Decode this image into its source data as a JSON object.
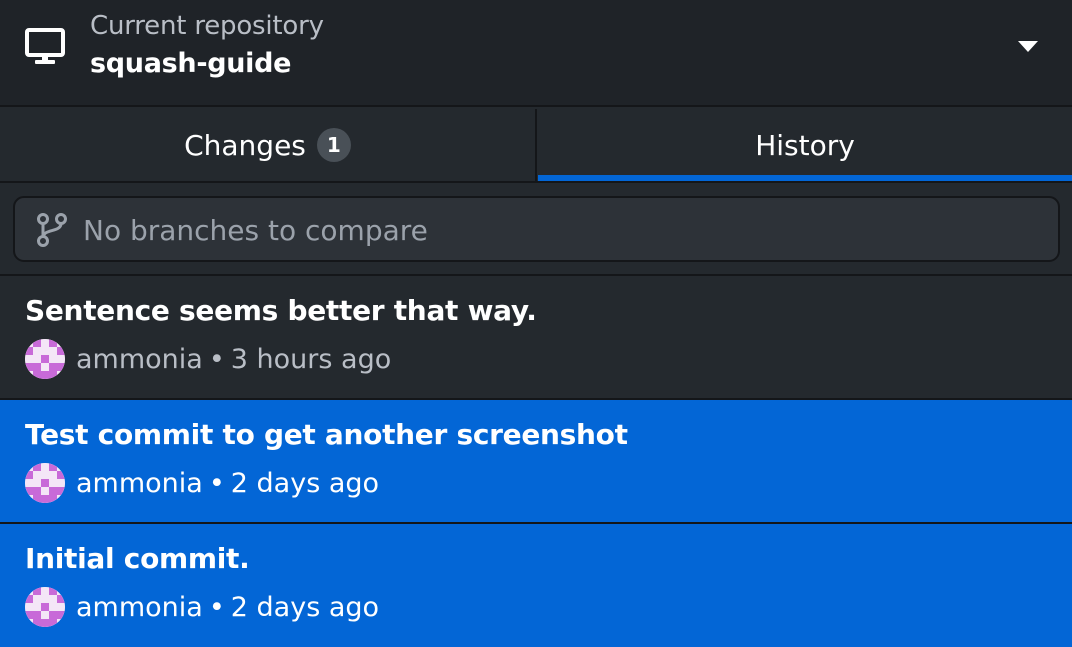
{
  "repo": {
    "label": "Current repository",
    "name": "squash-guide",
    "icon": "desktop-computer-icon",
    "dropdown_icon": "caret-down-icon"
  },
  "tabs": [
    {
      "label": "Changes",
      "badge": "1",
      "selected": false
    },
    {
      "label": "History",
      "selected": true
    }
  ],
  "compare": {
    "icon": "git-branch-icon",
    "text": "No branches to compare"
  },
  "commits": [
    {
      "title": "Sentence seems better that way.",
      "author": "ammonia",
      "separator": "•",
      "time": "3 hours ago",
      "selected": false
    },
    {
      "title": "Test commit to get another screenshot",
      "author": "ammonia",
      "separator": "•",
      "time": "2 days ago",
      "selected": true
    },
    {
      "title": "Initial commit.",
      "author": "ammonia",
      "separator": "•",
      "time": "2 days ago",
      "selected": true
    }
  ],
  "colors": {
    "accent": "#0366d6",
    "background": "#24292e",
    "header": "#1f2328",
    "avatar": "#c86ad8"
  }
}
